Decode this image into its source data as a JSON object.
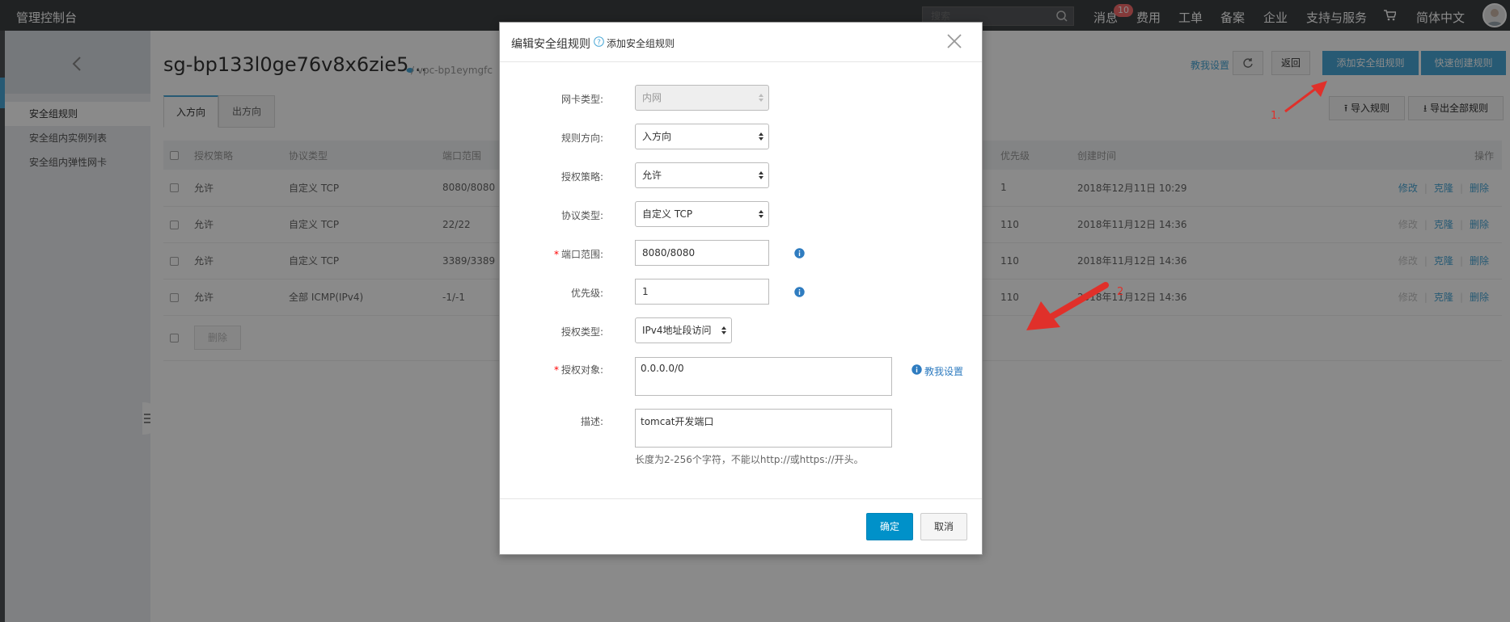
{
  "topbar": {
    "brand": "管理控制台",
    "search_placeholder": "搜索",
    "nav": [
      "消息",
      "费用",
      "工单",
      "备案",
      "企业",
      "支持与服务",
      "简体中文"
    ],
    "message_badge": "10"
  },
  "sidebar": {
    "items": [
      "安全组规则",
      "安全组内实例列表",
      "安全组内弹性网卡"
    ]
  },
  "main": {
    "title": "sg-bp133l0ge76v8x6zie5...",
    "vpc": "/ vpc-bp1eymgfc",
    "teach_link": "教我设置",
    "back_btn": "返回",
    "add_rule_btn": "添加安全组规则",
    "quick_create_btn": "快速创建规则",
    "import_btn": "导入规则",
    "export_btn": "导出全部规则",
    "tabs": [
      "入方向",
      "出方向"
    ],
    "table": {
      "headers": [
        "授权策略",
        "协议类型",
        "端口范围",
        "优先级",
        "创建时间",
        "操作"
      ],
      "rows": [
        {
          "policy": "允许",
          "proto": "自定义 TCP",
          "port": "8080/8080",
          "priority": "1",
          "time": "2018年12月11日 10:29",
          "edit_enabled": true
        },
        {
          "policy": "允许",
          "proto": "自定义 TCP",
          "port": "22/22",
          "priority": "110",
          "time": "2018年11月12日 14:36",
          "edit_enabled": false
        },
        {
          "policy": "允许",
          "proto": "自定义 TCP",
          "port": "3389/3389",
          "priority": "110",
          "time": "2018年11月12日 14:36",
          "edit_enabled": false
        },
        {
          "policy": "允许",
          "proto": "全部 ICMP(IPv4)",
          "port": "-1/-1",
          "priority": "110",
          "time": "2018年11月12日 14:36",
          "edit_enabled": false
        }
      ],
      "ops": {
        "edit": "修改",
        "clone": "克隆",
        "delete": "删除"
      },
      "bulk_delete": "删除"
    }
  },
  "modal": {
    "title": "编辑安全组规则",
    "sublink": "添加安全组规则",
    "fields": {
      "nic_type": {
        "label": "网卡类型:",
        "value": "内网"
      },
      "direction": {
        "label": "规则方向:",
        "value": "入方向"
      },
      "policy": {
        "label": "授权策略:",
        "value": "允许"
      },
      "protocol": {
        "label": "协议类型:",
        "value": "自定义 TCP"
      },
      "port_range": {
        "label": "端口范围:",
        "value": "8080/8080"
      },
      "priority": {
        "label": "优先级:",
        "value": "1"
      },
      "auth_type": {
        "label": "授权类型:",
        "value": "IPv4地址段访问"
      },
      "auth_object": {
        "label": "授权对象:",
        "value": "0.0.0.0/0",
        "teach": "教我设置"
      },
      "description": {
        "label": "描述:",
        "value": "tomcat开发端口",
        "hint": "长度为2-256个字符，不能以http://或https://开头。"
      }
    },
    "ok_btn": "确定",
    "cancel_btn": "取消"
  },
  "annotations": {
    "step1": "1.",
    "step2": "2"
  },
  "colors": {
    "accent": "#49a7d6",
    "ok_button": "#0091c9",
    "annotation": "#e0302a"
  }
}
